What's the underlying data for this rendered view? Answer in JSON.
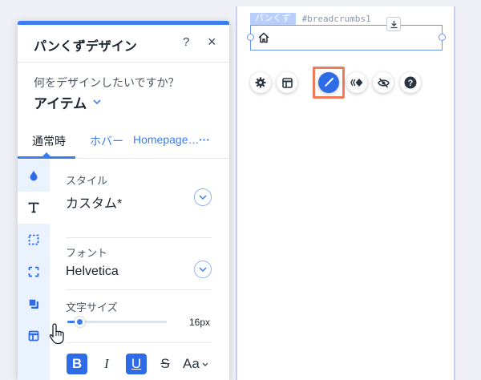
{
  "canvas": {
    "breadcrumb_tag_name": "パンくず",
    "breadcrumb_tag_id": "#breadcrumbs1"
  },
  "panel": {
    "title": "パンくずデザイン",
    "help_label": "?",
    "close_label": "×",
    "question": "何をデザインしたいですか？",
    "design_target": "アイテム",
    "tabs": [
      {
        "label": "通常時"
      },
      {
        "label": "ホバー"
      },
      {
        "label": "Homepage…"
      },
      {
        "label": "···"
      }
    ],
    "style_label": "スタイル",
    "style_value": "カスタム*",
    "font_label": "フォント",
    "font_value": "Helvetica",
    "size_label": "文字サイズ",
    "size_value": "16px",
    "size_fraction": 0.12,
    "format_buttons": [
      {
        "label": "B",
        "active": true
      },
      {
        "label": "I",
        "active": false
      },
      {
        "label": "U",
        "active": true
      },
      {
        "label": "S",
        "active": false
      },
      {
        "label": "Aa",
        "active": false
      }
    ]
  },
  "colors": {
    "accent": "#3b7dee",
    "active_button": "#2e6be6",
    "highlight": "#f07a5a"
  }
}
